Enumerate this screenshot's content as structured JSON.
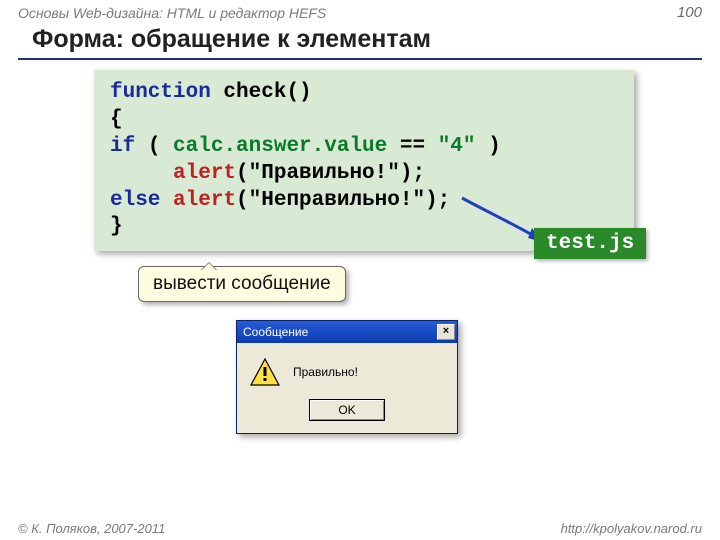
{
  "header": {
    "course_title": "Основы Web-дизайна: HTML и редактор HEFS",
    "page_number": "100"
  },
  "slide_title": "Форма: обращение к элементам",
  "code": {
    "l1a": "function",
    "l1b": " check()",
    "l2": "{",
    "l3a": "if",
    "l3b": " ( ",
    "l3c": "calc.answer.value",
    "l3d": " == ",
    "l3e": "\"4\"",
    "l3f": " )",
    "l4pad": "     ",
    "l4a": "alert",
    "l4b": "(\"Правильно!\");",
    "l5a": "else",
    "l5b": " ",
    "l5c": "alert",
    "l5d": "(\"Неправильно!\");",
    "l6": "}"
  },
  "callout_text": "вывести сообщение",
  "badge_text": "test.js",
  "dialog": {
    "title": "Сообщение",
    "close": "×",
    "message": "Правильно!",
    "ok": "OK"
  },
  "footer": {
    "copyright": "© К. Поляков, 2007-2011",
    "url": "http://kpolyakov.narod.ru"
  }
}
